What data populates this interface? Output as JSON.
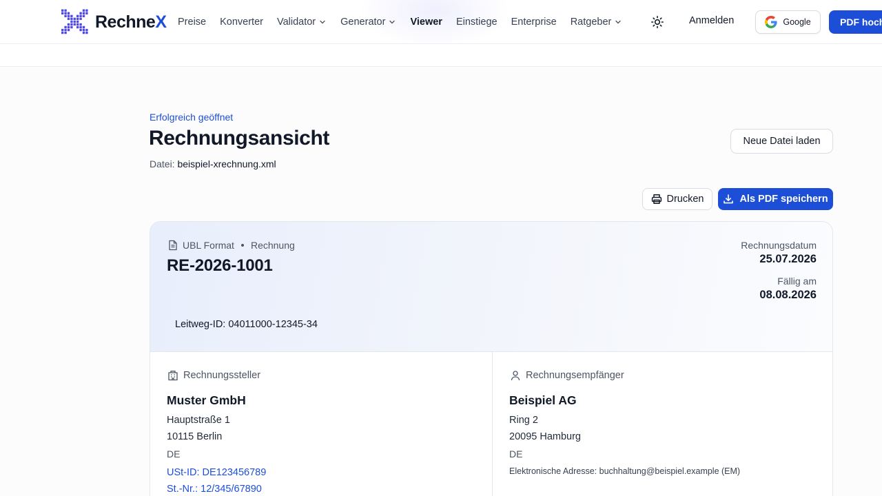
{
  "header": {
    "brand_main": "Rechne",
    "brand_x": "X",
    "nav": [
      {
        "label": "Preise",
        "dropdown": false,
        "active": false
      },
      {
        "label": "Konverter",
        "dropdown": false,
        "active": false
      },
      {
        "label": "Validator",
        "dropdown": true,
        "active": false
      },
      {
        "label": "Generator",
        "dropdown": true,
        "active": false
      },
      {
        "label": "Viewer",
        "dropdown": false,
        "active": true
      },
      {
        "label": "Einstiege",
        "dropdown": false,
        "active": false
      },
      {
        "label": "Enterprise",
        "dropdown": false,
        "active": false
      },
      {
        "label": "Ratgeber",
        "dropdown": true,
        "active": false
      }
    ],
    "theme_icon": "sun-icon",
    "login_label": "Anmelden",
    "google_label": "Google",
    "upload_label": "PDF hoch"
  },
  "page": {
    "status": "Erfolgreich geöffnet",
    "title": "Rechnungsansicht",
    "file_prefix": "Datei:",
    "file_name": "beispiel-xrechnung.xml",
    "new_file_label": "Neue Datei laden",
    "print_label": "Drucken",
    "save_pdf_label": "Als PDF speichern"
  },
  "invoice": {
    "format": "UBL Format",
    "doc_type": "Rechnung",
    "number": "RE-2026-1001",
    "date_label": "Rechnungsdatum",
    "date_value": "25.07.2026",
    "due_label": "Fällig am",
    "due_value": "08.08.2026",
    "leitweg": "Leitweg-ID: 04011000-12345-34",
    "seller": {
      "label": "Rechnungssteller",
      "name": "Muster GmbH",
      "street": "Hauptstraße 1",
      "city": "10115 Berlin",
      "country": "DE",
      "vat_id": "USt-ID: DE123456789",
      "tax_no": "St.-Nr.: 12/345/67890"
    },
    "buyer": {
      "label": "Rechnungsempfänger",
      "name": "Beispiel AG",
      "street": "Ring 2",
      "city": "20095 Hamburg",
      "country": "DE",
      "e_address": "Elektronische Adresse: buchhaltung@beispiel.example (EM)"
    }
  },
  "colors": {
    "accent": "#1d4ed8",
    "text": "#111827",
    "muted": "#4b5563",
    "card_header": "#e8eefc"
  }
}
